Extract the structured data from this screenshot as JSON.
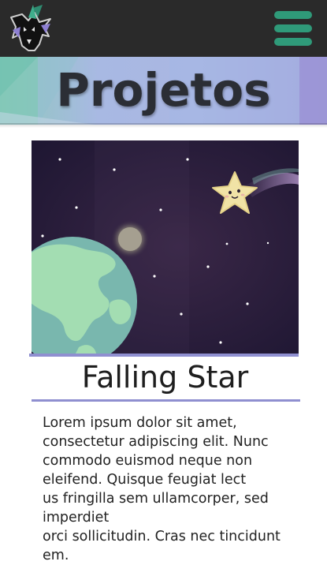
{
  "header": {
    "logo": "wolf-logo-icon",
    "menu_icon": "hamburger-menu-icon",
    "menu_color": "#2f9a79",
    "background": "#2a2a2a"
  },
  "banner": {
    "title": "Projetos"
  },
  "project": {
    "image": "space-illustration-earth-moon-star",
    "title": "Falling Star",
    "description": "Lorem ipsum dolor sit amet,\nconsectetur  adipiscing elit. Nunc\ncommodo euismod neque non\neleifend. Quisque feugiat lect\nus fringilla sem ullamcorper, sed\nimperdiet\norci sollicitudin. Cras nec tincidunt\nem.",
    "accent_color": "#8f8fd0"
  }
}
